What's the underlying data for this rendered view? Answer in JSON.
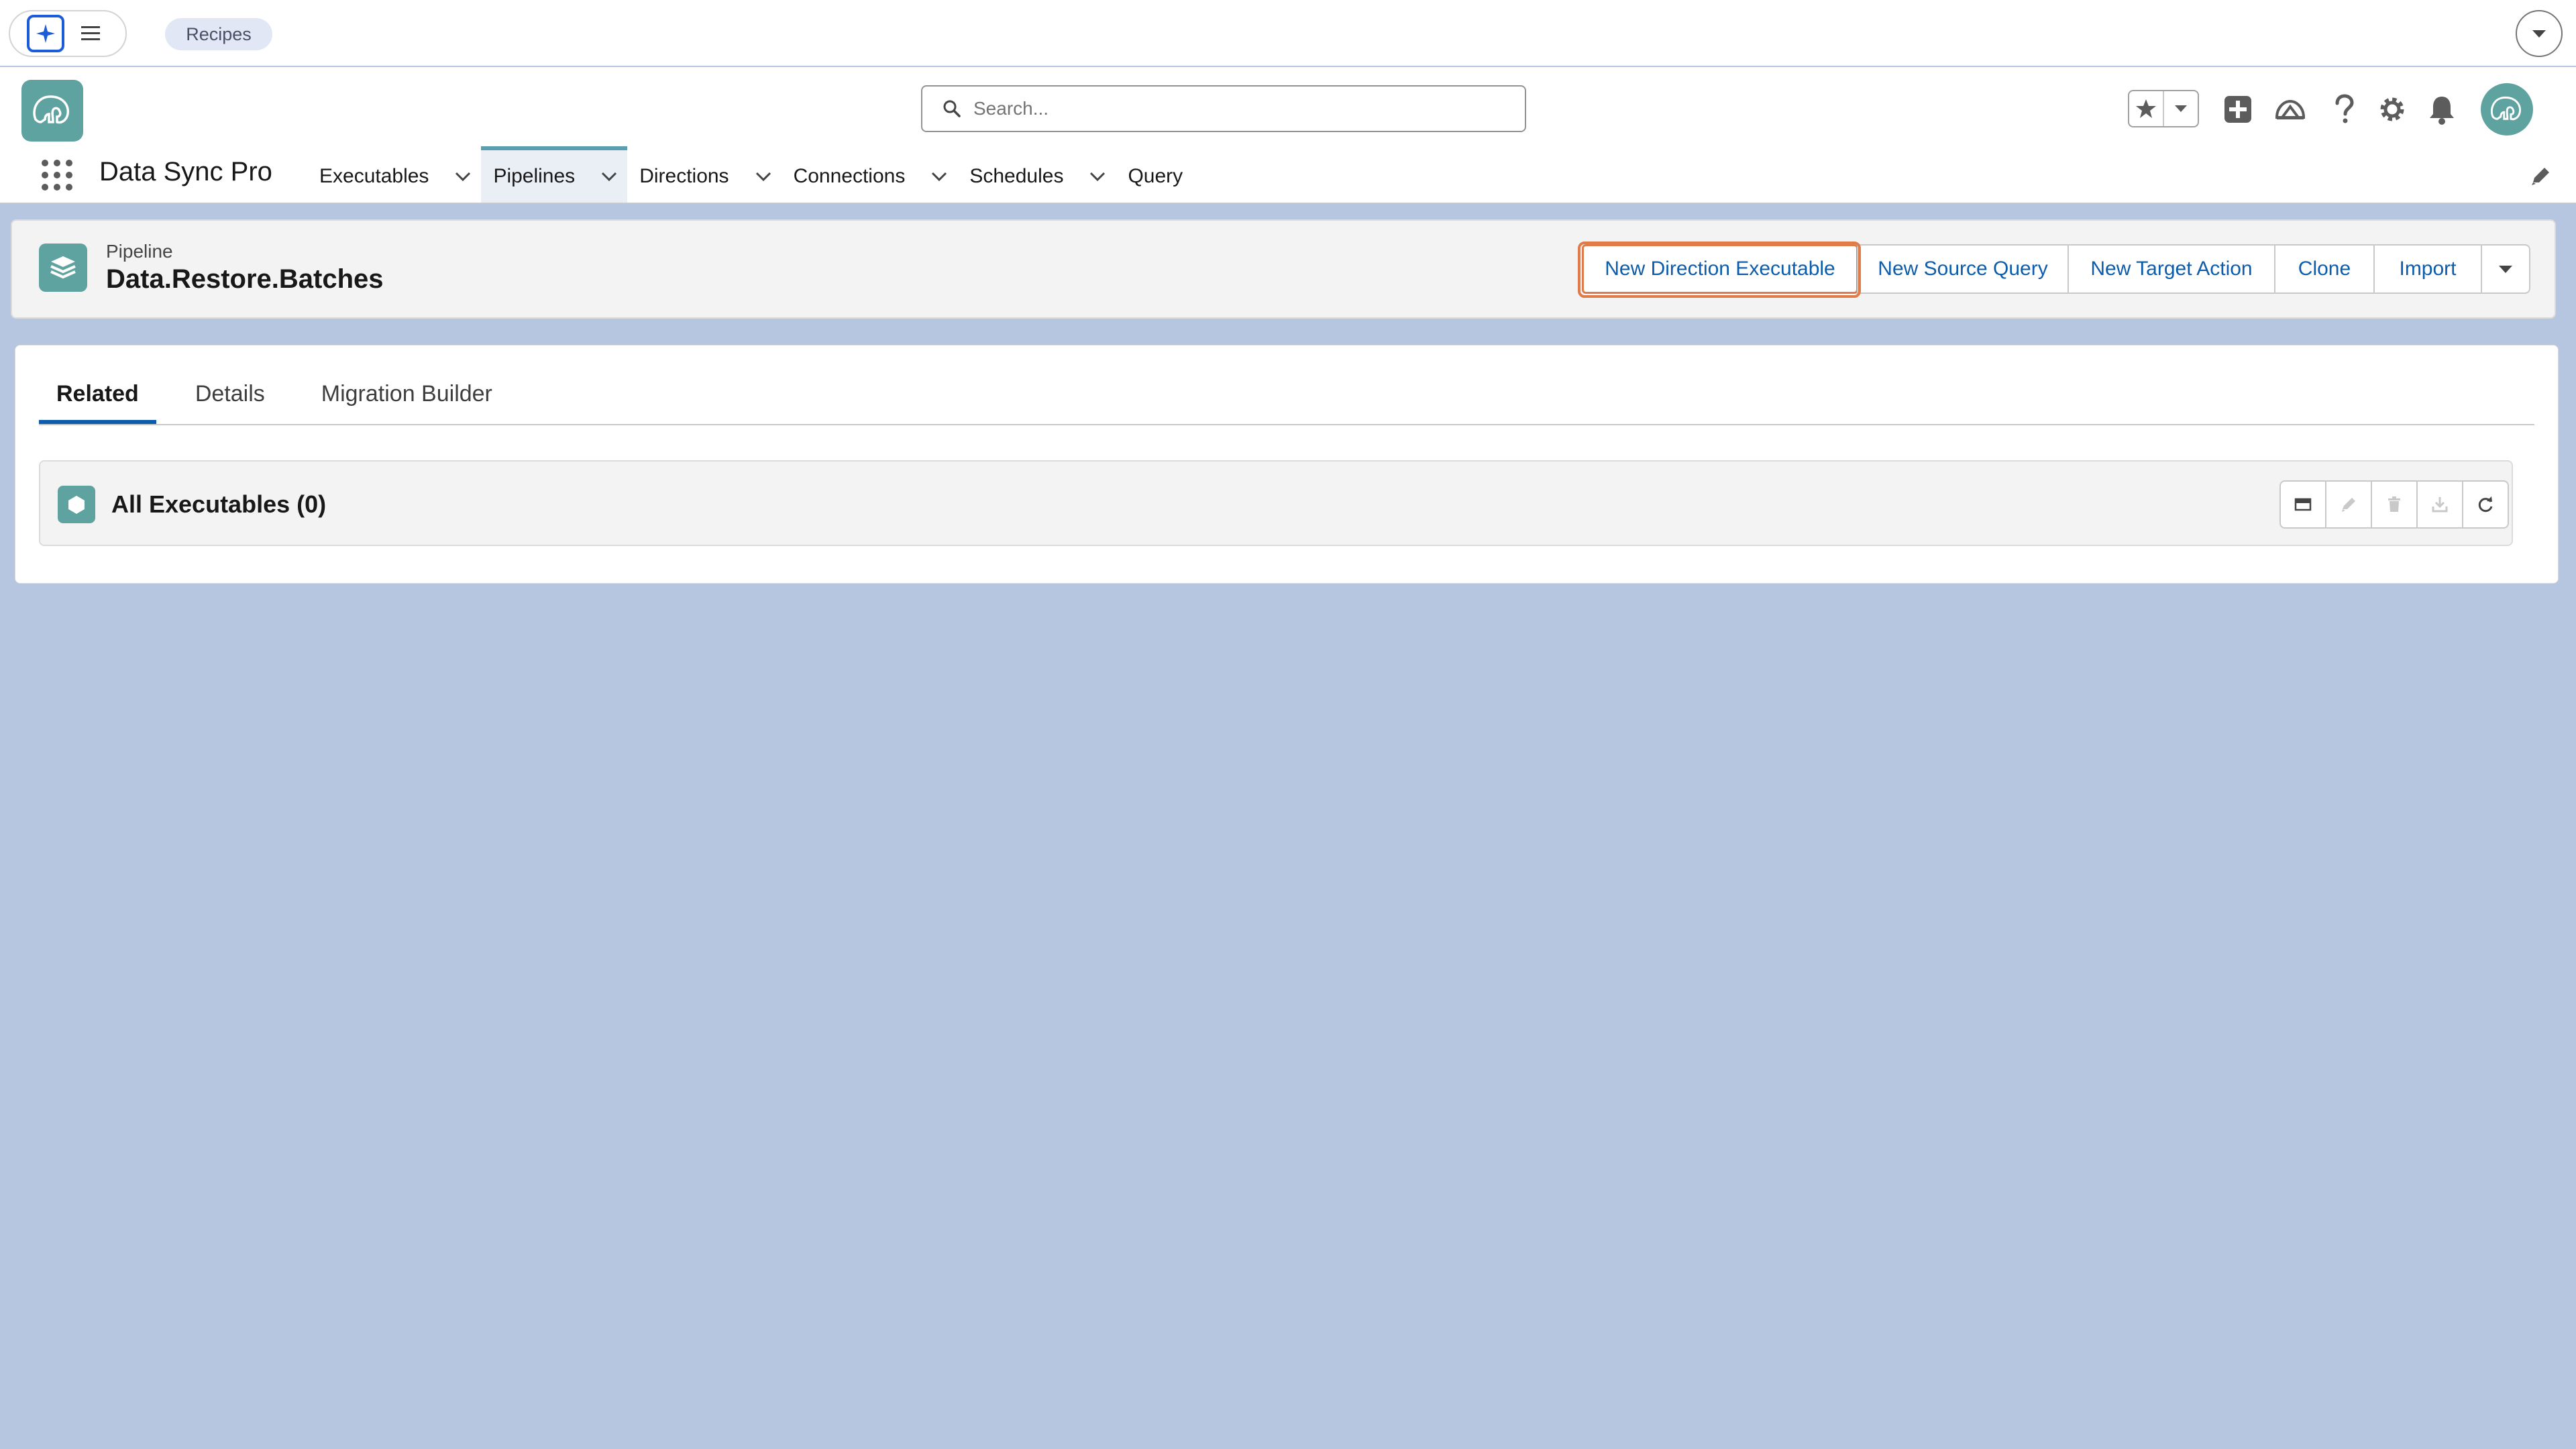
{
  "utility_bar": {
    "recipes_chip": "Recipes",
    "icons": [
      "agent-icon",
      "hamburger-icon",
      "chevron-down-icon"
    ]
  },
  "header": {
    "search": {
      "placeholder": "Search..."
    },
    "icons": [
      "favorites-star-icon",
      "chevron-down-icon",
      "global-add-icon",
      "trailhead-icon",
      "help-icon",
      "setup-gear-icon",
      "notifications-bell-icon",
      "avatar"
    ]
  },
  "nav": {
    "app_name": "Data Sync Pro",
    "tabs": [
      {
        "label": "Executables",
        "has_menu": true,
        "active": false
      },
      {
        "label": "Pipelines",
        "has_menu": true,
        "active": true
      },
      {
        "label": "Directions",
        "has_menu": true,
        "active": false
      },
      {
        "label": "Connections",
        "has_menu": true,
        "active": false
      },
      {
        "label": "Schedules",
        "has_menu": true,
        "active": false
      },
      {
        "label": "Query",
        "has_menu": false,
        "active": false
      }
    ]
  },
  "record": {
    "object_label": "Pipeline",
    "name": "Data.Restore.Batches",
    "actions": [
      "New Direction Executable",
      "New Source Query",
      "New Target Action",
      "Clone",
      "Import"
    ],
    "focused_action": "New Direction Executable"
  },
  "tabs": {
    "items": [
      "Related",
      "Details",
      "Migration Builder"
    ],
    "active": "Related"
  },
  "related_list": {
    "title": "All Executables (0)",
    "tools": [
      "table-view-icon",
      "edit-icon",
      "delete-icon",
      "download-icon",
      "refresh-icon"
    ]
  },
  "colors": {
    "page_background": "#b7c6e0",
    "brand_teal": "#5fa3a0",
    "link_blue": "#0b5cab",
    "focus_orange": "#e07b4a",
    "active_tab_underline": "#0b5cab"
  }
}
